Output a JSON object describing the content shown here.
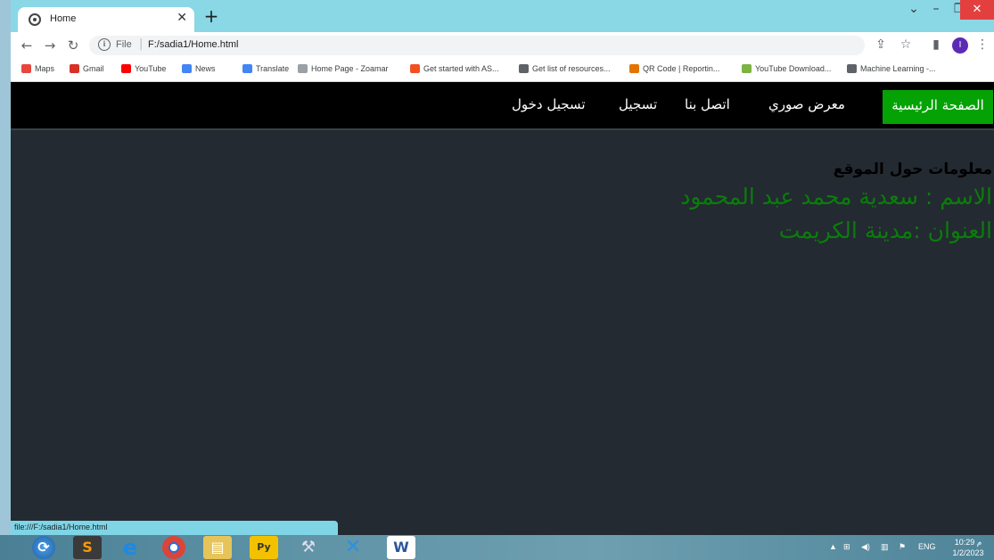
{
  "browser": {
    "tab_title": "Home",
    "url_scheme": "File",
    "url": "F:/sadia1/Home.html",
    "profile_initial": "I",
    "status_url": "file:///F:/sadia1/Home.html"
  },
  "bookmarks": [
    {
      "label": "Maps",
      "icon": "maps-pin-icon",
      "color": "#e8453c"
    },
    {
      "label": "Gmail",
      "icon": "gmail-icon",
      "color": "#d93025"
    },
    {
      "label": "YouTube",
      "icon": "youtube-icon",
      "color": "#ff0000"
    },
    {
      "label": "News",
      "icon": "news-icon",
      "color": "#4285f4"
    },
    {
      "label": "Translate",
      "icon": "translate-icon",
      "color": "#4285f4"
    },
    {
      "label": "Home Page - Zoamar",
      "icon": "page-icon",
      "color": "#9aa0a6"
    },
    {
      "label": "Get started with AS...",
      "icon": "microsoft-icon",
      "color": "#f25022"
    },
    {
      "label": "Get list of resources...",
      "icon": "globe-icon",
      "color": "#5f6368"
    },
    {
      "label": "QR Code | Reportin...",
      "icon": "qr-icon",
      "color": "#e37400"
    },
    {
      "label": "YouTube Download...",
      "icon": "download-icon",
      "color": "#7cb342"
    },
    {
      "label": "Machine Learning -...",
      "icon": "ml-icon",
      "color": "#5f6368"
    }
  ],
  "site": {
    "nav": {
      "home": "الصفحة الرئيسية",
      "gallery": "معرض صوري",
      "contact": "اتصل بنا",
      "register": "تسجيل",
      "login": "تسجيل دخول"
    },
    "info_title": "معلومات حول الموقع",
    "name_line": "الاسم :  سعدية محمد عبد المحمود",
    "address_line": "العنوان :مدينة الكريمت",
    "active_color": "#04a204",
    "text_green": "#0a7d0a"
  },
  "taskbar": {
    "lang": "ENG",
    "time": "10:29 م",
    "date": "1/2/2023"
  }
}
